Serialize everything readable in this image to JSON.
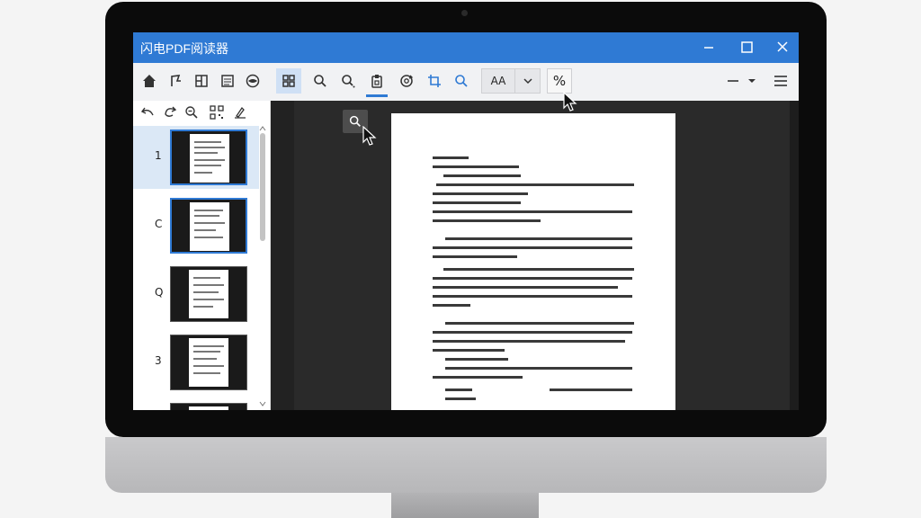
{
  "window": {
    "title": "闪电PDF阅读器",
    "controls": [
      "minimize-icon",
      "maximize-icon",
      "close-icon"
    ]
  },
  "toolbar": {
    "left_icons": [
      "home-icon",
      "edit-icon",
      "layout-icon",
      "document-icon",
      "eye-icon"
    ],
    "view_icons": [
      "grid-view-icon",
      "search-icon",
      "search-more-icon",
      "clipboard-icon",
      "rotate-search-icon",
      "crop-icon",
      "zoom-icon"
    ],
    "zoom_value": "AA",
    "percent_label": "%",
    "right_icons": [
      "minus-icon",
      "dropdown-icon",
      "menu-icon"
    ]
  },
  "sidebar": {
    "tool_icons": [
      "undo-icon",
      "redo-icon",
      "zoom-out-icon",
      "qr-icon",
      "annotate-icon"
    ],
    "thumbnails": [
      {
        "label": "1",
        "selected": true
      },
      {
        "label": "C",
        "selected": false
      },
      {
        "label": "Q",
        "selected": false
      },
      {
        "label": "3",
        "selected": false
      }
    ]
  },
  "colors": {
    "accent": "#2f7ad4",
    "viewer_bg": "#2a2a2a"
  }
}
